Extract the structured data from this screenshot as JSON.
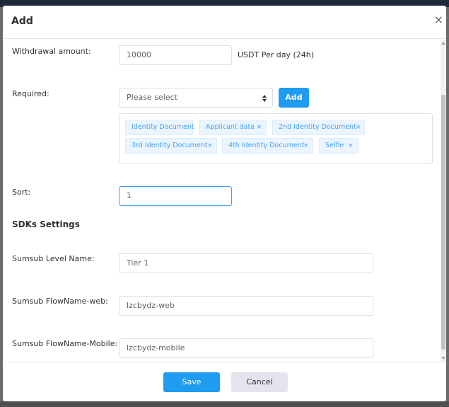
{
  "modal": {
    "title": "Add",
    "close_glyph": "×"
  },
  "withdrawal": {
    "label": "Withdrawal amount:",
    "value": "10000",
    "suffix": "USDT Per day (24h)"
  },
  "required": {
    "label": "Required:",
    "select_placeholder": "Please select",
    "add_button": "Add",
    "tags": [
      {
        "label": "Identity Document",
        "closable": false
      },
      {
        "label": "Applicant data",
        "closable": true
      },
      {
        "label": "2nd Identity Document",
        "closable": true
      },
      {
        "label": "3rd Identity Document",
        "closable": true
      },
      {
        "label": "4th Identity Document",
        "closable": true
      },
      {
        "label": "Selfie",
        "closable": true
      }
    ],
    "tag_close_glyph": "×"
  },
  "sort": {
    "label": "Sort:",
    "value": "1"
  },
  "sdk_settings": {
    "title": "SDKs Settings",
    "level_name_label": "Sumsub Level Name:",
    "level_name_value": "Tier 1",
    "flow_web_label": "Sumsub FlowName-web:",
    "flow_web_value": "lzcbydz-web",
    "flow_mobile_label": "Sumsub FlowName-Mobile:",
    "flow_mobile_value": "lzcbydz-mobile"
  },
  "footer": {
    "save_label": "Save",
    "cancel_label": "Cancel"
  },
  "colors": {
    "primary": "#1f9bf0",
    "tag_bg": "#ecf5ff",
    "tag_text": "#409eff",
    "cancel_bg": "#e4e4ee"
  }
}
